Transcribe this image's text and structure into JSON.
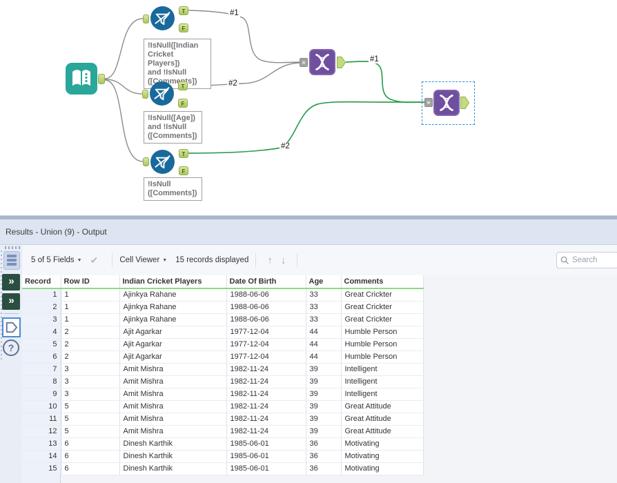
{
  "canvas": {
    "anchor_labels": {
      "true": "T",
      "false": "F"
    },
    "connection_labels": {
      "filter1_true": "#1",
      "filter2_true": "#2",
      "union1_out": "#1",
      "filter3_true": "#2"
    },
    "filters": [
      {
        "annotation": "!IsNull([Indian\nCricket Players])\nand !IsNull\n([Comments])"
      },
      {
        "annotation": "!IsNull([Age])\nand !IsNull\n([Comments])"
      },
      {
        "annotation": "!IsNull\n([Comments])"
      }
    ]
  },
  "results": {
    "title": "Results - Union (9) - Output",
    "toolbar": {
      "fields": "5 of 5 Fields",
      "cell_viewer": "Cell Viewer",
      "records": "15 records displayed",
      "search_placeholder": "Search"
    },
    "table": {
      "columns": [
        "Record",
        "Row ID",
        "Indian Cricket Players",
        "Date Of Birth",
        "Age",
        "Comments"
      ],
      "rows": [
        [
          "1",
          "1",
          "Ajinkya Rahane",
          "1988-06-06",
          "33",
          "Great Crickter"
        ],
        [
          "2",
          "1",
          "Ajinkya Rahane",
          "1988-06-06",
          "33",
          "Great Crickter"
        ],
        [
          "3",
          "1",
          "Ajinkya Rahane",
          "1988-06-06",
          "33",
          "Great Crickter"
        ],
        [
          "4",
          "2",
          "Ajit Agarkar",
          "1977-12-04",
          "44",
          "Humble Person"
        ],
        [
          "5",
          "2",
          "Ajit Agarkar",
          "1977-12-04",
          "44",
          "Humble Person"
        ],
        [
          "6",
          "2",
          "Ajit Agarkar",
          "1977-12-04",
          "44",
          "Humble Person"
        ],
        [
          "7",
          "3",
          "Amit Mishra",
          "1982-11-24",
          "39",
          "Intelligent"
        ],
        [
          "8",
          "3",
          "Amit Mishra",
          "1982-11-24",
          "39",
          "Intelligent"
        ],
        [
          "9",
          "3",
          "Amit Mishra",
          "1982-11-24",
          "39",
          "Intelligent"
        ],
        [
          "10",
          "5",
          "Amit Mishra",
          "1982-11-24",
          "39",
          "Great Attitude"
        ],
        [
          "11",
          "5",
          "Amit Mishra",
          "1982-11-24",
          "39",
          "Great Attitude"
        ],
        [
          "12",
          "5",
          "Amit Mishra",
          "1982-11-24",
          "39",
          "Great Attitude"
        ],
        [
          "13",
          "6",
          "Dinesh Karthik",
          "1985-06-01",
          "36",
          "Motivating"
        ],
        [
          "14",
          "6",
          "Dinesh Karthik",
          "1985-06-01",
          "36",
          "Motivating"
        ],
        [
          "15",
          "6",
          "Dinesh Karthik",
          "1985-06-01",
          "36",
          "Motivating"
        ]
      ]
    }
  },
  "colors": {
    "connection_green": "#2f9e4f",
    "connection_gray": "#8c8c8c",
    "tool_blue": "#19699c",
    "tool_teal": "#2aa69a",
    "tool_purple": "#6f4f9f",
    "header_underline": "#8fd886",
    "selection_blue": "#2e8fd6"
  }
}
